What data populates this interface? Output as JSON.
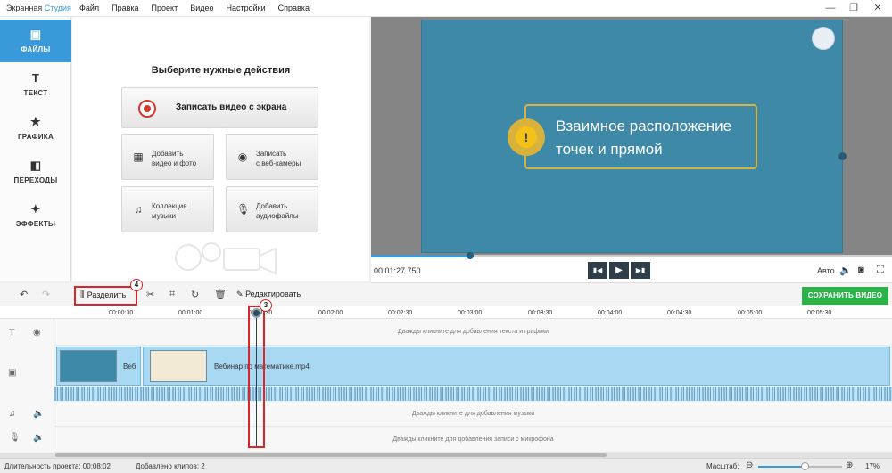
{
  "app": {
    "title_part1": "Экранная",
    "title_part2": "Студия"
  },
  "menu": [
    "Файл",
    "Правка",
    "Проект",
    "Видео",
    "Настройки",
    "Справка"
  ],
  "window_controls": [
    "—",
    "❐",
    "✕"
  ],
  "sidebar": {
    "items": [
      {
        "label": "ФАЙЛЫ",
        "icon": "files-icon",
        "glyph": "▣",
        "active": true
      },
      {
        "label": "ТЕКСТ",
        "icon": "text-icon",
        "glyph": "T",
        "active": false
      },
      {
        "label": "ГРАФИКА",
        "icon": "star-icon",
        "glyph": "★",
        "active": false
      },
      {
        "label": "ПЕРЕХОДЫ",
        "icon": "transitions-icon",
        "glyph": "◧",
        "active": false
      },
      {
        "label": "ЭФФЕКТЫ",
        "icon": "magic-wand-icon",
        "glyph": "✦",
        "active": false
      }
    ]
  },
  "actions": {
    "title": "Выберите нужные действия",
    "record_screen": "Записать видео с экрана",
    "add_video": [
      "Добавить",
      "видео и фото"
    ],
    "webcam": [
      "Записать",
      "с веб-камеры"
    ],
    "music": [
      "Коллекция",
      "музыки"
    ],
    "audio": [
      "Добавить",
      "аудиофайлы"
    ]
  },
  "preview": {
    "slide_text": [
      "Взаимное расположение",
      "точек и прямой"
    ],
    "badge": "!",
    "time": "00:01:27.750",
    "progress": 0.19,
    "quality": "Авто"
  },
  "toolbar": {
    "split": "Разделить",
    "edit": "Редактировать",
    "save": "СОХРАНИТЬ ВИДЕО"
  },
  "markers": {
    "split_marker": "4",
    "playhead_marker": "3"
  },
  "ruler": {
    "ticks": [
      "00:00:30",
      "00:01:00",
      "00:01:30",
      "00:02:00",
      "00:02:30",
      "00:03:00",
      "00:03:30",
      "00:04:00",
      "00:04:30",
      "00:05:00",
      "00:05:30"
    ]
  },
  "timeline": {
    "text_hint": "Дважды кликните для добавления текста и графики",
    "clip1_label": "Веб",
    "clip2_label": "Вебинар по математике.mp4",
    "music_hint": "Дважды кликните для добавления музыки",
    "mic_hint": "Дважды кликните для добавления записи с микрофона"
  },
  "status": {
    "duration": "Длительность проекта: 00:08:02",
    "clips": "Добавлено клипов: 2",
    "scale_label": "Масштаб:",
    "zoom": "17%",
    "zoom_fraction": 0.55
  },
  "colors": {
    "accent": "#3a9ad9",
    "save": "#2db24a",
    "highlight": "#d9262b",
    "slide": "#3f89a8"
  }
}
